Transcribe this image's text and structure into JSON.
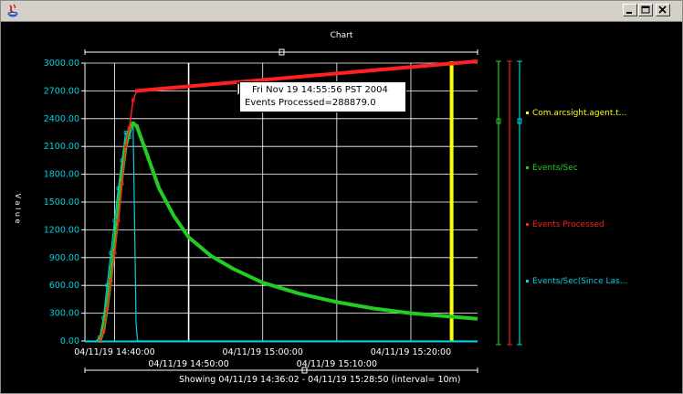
{
  "window": {
    "title": ""
  },
  "chart_data": {
    "type": "line",
    "title": "Chart",
    "ylabel": "V a l u e",
    "xlabel": "",
    "y_ticks": [
      "0.00",
      "300.00",
      "600.00",
      "900.00",
      "1200.00",
      "1500.00",
      "1800.00",
      "2100.00",
      "2400.00",
      "2700.00",
      "3000.00"
    ],
    "ylim": [
      0,
      3000
    ],
    "x_ticks_top_row": [
      "04/11/19 14:40:00",
      "04/11/19 15:00:00",
      "04/11/19 15:20:00"
    ],
    "x_ticks_bottom_row": [
      "04/11/19 14:50:00",
      "04/11/19 15:10:00"
    ],
    "x_range_minutes": [
      -4,
      49
    ],
    "x_origin_label": "04/11/19 14:40:00",
    "grid": true,
    "legend_placement": "right",
    "showing_text": "Showing  04/11/19 14:36:02 - 04/11/19 15:28:50  (interval= 10m)",
    "series": [
      {
        "name": "Com.arcsight.agent.t...",
        "color": "#ffff00"
      },
      {
        "name": "Events/Sec",
        "color": "#22cc22"
      },
      {
        "name": "Events Processed",
        "color": "#ff2020"
      },
      {
        "name": "Events/Sec(Since Las...",
        "color": "#00d0e0"
      }
    ],
    "events_processed_points": [
      [
        -2.0,
        0
      ],
      [
        -1.5,
        100
      ],
      [
        -1.0,
        350
      ],
      [
        -0.5,
        650
      ],
      [
        0.0,
        950
      ],
      [
        0.5,
        1300
      ],
      [
        1.0,
        1700
      ],
      [
        1.5,
        2100
      ],
      [
        2.0,
        2300
      ],
      [
        2.5,
        2600
      ],
      [
        3.0,
        2700
      ],
      [
        49.0,
        3020
      ]
    ],
    "events_sec_points": [
      [
        -2.0,
        0
      ],
      [
        -1.5,
        120
      ],
      [
        -1.0,
        380
      ],
      [
        -0.5,
        700
      ],
      [
        0.0,
        1050
      ],
      [
        0.5,
        1400
      ],
      [
        1.0,
        1800
      ],
      [
        1.5,
        2100
      ],
      [
        2.0,
        2280
      ],
      [
        2.5,
        2350
      ],
      [
        3.0,
        2320
      ],
      [
        4.0,
        2100
      ],
      [
        6.0,
        1650
      ],
      [
        8.0,
        1350
      ],
      [
        10.0,
        1120
      ],
      [
        13.0,
        920
      ],
      [
        16.0,
        780
      ],
      [
        20.0,
        630
      ],
      [
        25.0,
        510
      ],
      [
        30.0,
        420
      ],
      [
        35.0,
        350
      ],
      [
        40.0,
        300
      ],
      [
        45.0,
        265
      ],
      [
        49.0,
        240
      ]
    ],
    "events_sec_since_last_points": [
      [
        -4.0,
        0
      ],
      [
        -2.5,
        0
      ],
      [
        -2.0,
        40
      ],
      [
        -1.5,
        250
      ],
      [
        -1.0,
        600
      ],
      [
        -0.5,
        950
      ],
      [
        0.0,
        1300
      ],
      [
        0.5,
        1650
      ],
      [
        1.0,
        1950
      ],
      [
        1.5,
        2250
      ],
      [
        2.0,
        2200
      ],
      [
        2.5,
        2350
      ],
      [
        2.7,
        1300
      ],
      [
        2.9,
        200
      ],
      [
        3.1,
        0
      ],
      [
        49.0,
        0
      ]
    ],
    "agent_marker_x": 45.5,
    "tooltip": {
      "line1": "Fri Nov 19 14:55:56 PST 2004",
      "line2": "Events Processed=288879.0",
      "x": 14.4,
      "y": 2830
    }
  }
}
